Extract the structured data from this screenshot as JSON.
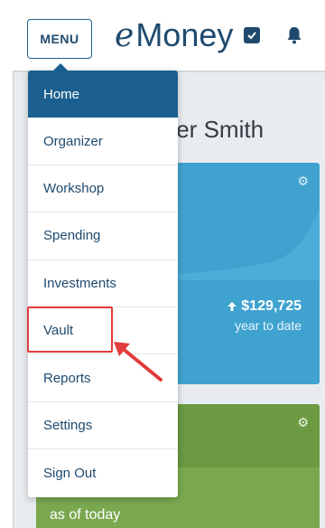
{
  "header": {
    "menu_label": "MENU",
    "brand_e": "e",
    "brand_word": "Money",
    "bell_icon": "bell-icon"
  },
  "main": {
    "greeting_partial": "ter Smith",
    "ytd_amount": "$129,725",
    "ytd_label": "year to date",
    "green_label": "as of today"
  },
  "menu": {
    "items": [
      {
        "label": "Home",
        "active": true
      },
      {
        "label": "Organizer"
      },
      {
        "label": "Workshop"
      },
      {
        "label": "Spending"
      },
      {
        "label": "Investments"
      },
      {
        "label": "Vault"
      },
      {
        "label": "Reports"
      },
      {
        "label": "Settings"
      },
      {
        "label": "Sign Out"
      }
    ]
  },
  "annotation": {
    "color": "#e23b3b"
  },
  "colors": {
    "primary": "#1f4a6e",
    "menu_active": "#1a5f8e",
    "card_blue": "#3fa2cf",
    "card_green": "#7aa84f"
  }
}
